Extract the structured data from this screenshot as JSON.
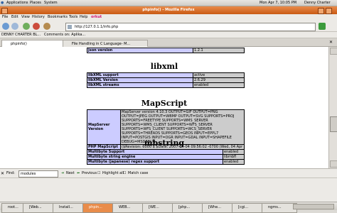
{
  "gnome_panel": {
    "menus": [
      "Applications",
      "Places",
      "System"
    ],
    "clock": "Mon Apr 7, 10:05 PM",
    "user": "Denny Charter"
  },
  "window": {
    "title": "phpinfo() - Mozilla Firefox"
  },
  "menubar": {
    "items": [
      "File",
      "Edit",
      "View",
      "History",
      "Bookmarks",
      "Tools",
      "Help"
    ],
    "brand": "orkut"
  },
  "urlbar": {
    "url": "http://127.0.1.1/info.php"
  },
  "bookmarks": {
    "items": [
      "DENNY CHARTER BL...",
      "Comments on: Aplika..."
    ]
  },
  "tabs": [
    {
      "label": "phpinfo()",
      "active": true
    },
    {
      "label": "File Handling in C Language- M..."
    }
  ],
  "content": {
    "json_row": {
      "key": "json version",
      "value": "1.2.1"
    },
    "libxml": {
      "heading": "libxml",
      "rows": [
        {
          "key": "libXML support",
          "value": "active"
        },
        {
          "key": "libXML Version",
          "value": "2.6.29"
        },
        {
          "key": "libXML streams",
          "value": "enabled"
        }
      ]
    },
    "mapscript": {
      "heading": "MapScript",
      "rows": [
        {
          "key": "MapServer Version",
          "value": "MapServer version 4.10.3 OUTPUT=GIF OUTPUT=PNG OUTPUT=JPEG OUTPUT=WBMP OUTPUT=SVG SUPPORTS=PROJ SUPPORTS=FREETYPE SUPPORTS=WMS_SERVER SUPPORTS=WMS_CLIENT SUPPORTS=WFS_SERVER SUPPORTS=WFS_CLIENT SUPPORTS=WCS_SERVER SUPPORTS=THREADS SUPPORTS=GEOS INPUT=EPPL7 INPUT=POSTGIS INPUT=OGR INPUT=GDAL INPUT=SHAPEFILE DEBUG=MSDEBUG"
        },
        {
          "key": "PHP MapScript Version",
          "value": "($Revision: 6000 $ $Date: 2007-04-04 09:56:02 -0700 (Wed, 04 Apr 2007) $)"
        }
      ]
    },
    "mbstring": {
      "heading": "mbstring",
      "rows": [
        {
          "key": "Multibyte Support",
          "value": "enabled"
        },
        {
          "key": "Multibyte string engine",
          "value": "libmbfl"
        },
        {
          "key": "Multibyte (japanese) regex support",
          "value": "enabled"
        }
      ]
    }
  },
  "findbar": {
    "label": "Find:",
    "value": "modules",
    "next": "Next",
    "previous": "Previous",
    "highlight": "Highlight all",
    "match_case": "Match case"
  },
  "taskbar": {
    "items": [
      "root...",
      "[Web...",
      "Install...",
      "phpin...",
      "WEB...",
      "[WE...",
      "[php...",
      "[Whe...",
      "[cgi...",
      "ngms..."
    ],
    "active_index": 3
  }
}
